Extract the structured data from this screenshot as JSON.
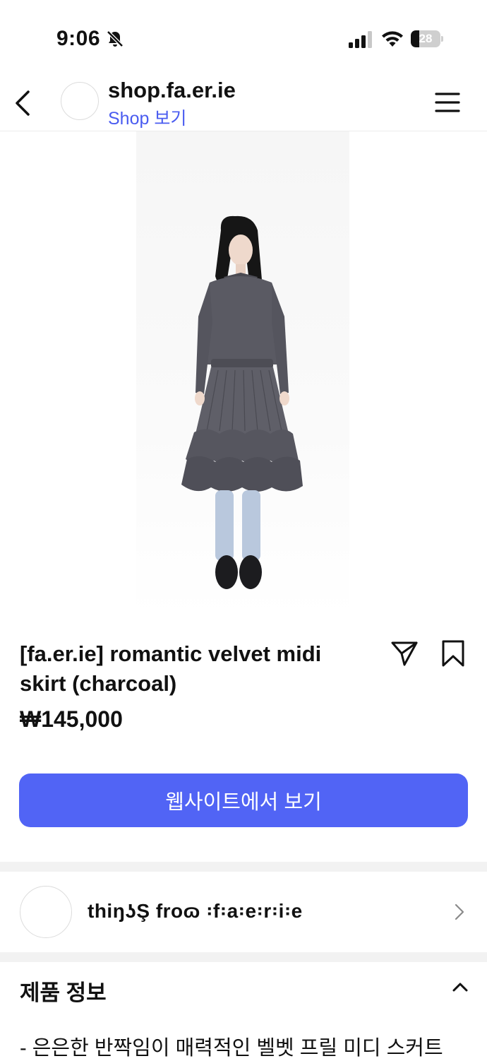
{
  "status_bar": {
    "time": "9:06",
    "battery_level": "28",
    "battery_fraction": 0.28,
    "icons": [
      "bell-off-icon",
      "signal-icon",
      "wifi-icon",
      "battery-icon"
    ]
  },
  "header": {
    "shop_name": "shop.fa.er.ie",
    "shop_link": "Shop 보기",
    "icons": [
      "back-icon",
      "menu-icon"
    ]
  },
  "product": {
    "title": "[fa.er.ie] romantic velvet midi skirt (charcoal)",
    "price": "₩145,000",
    "website_button": "웹사이트에서 보기",
    "icons": [
      "share-icon",
      "bookmark-icon"
    ]
  },
  "shop_row": {
    "name": "thiŋʖŞ froɷ ꞉f꞉a꞉e꞉r꞉i꞉e"
  },
  "info": {
    "title": "제품 정보",
    "description": "- 은은한 반짝임이 매력적인 벨벳 프릴 미디 스커트"
  },
  "colors": {
    "accent": "#5164f5",
    "link": "#4a5cf0",
    "text": "#111111",
    "separator": "#f2f2f2"
  }
}
